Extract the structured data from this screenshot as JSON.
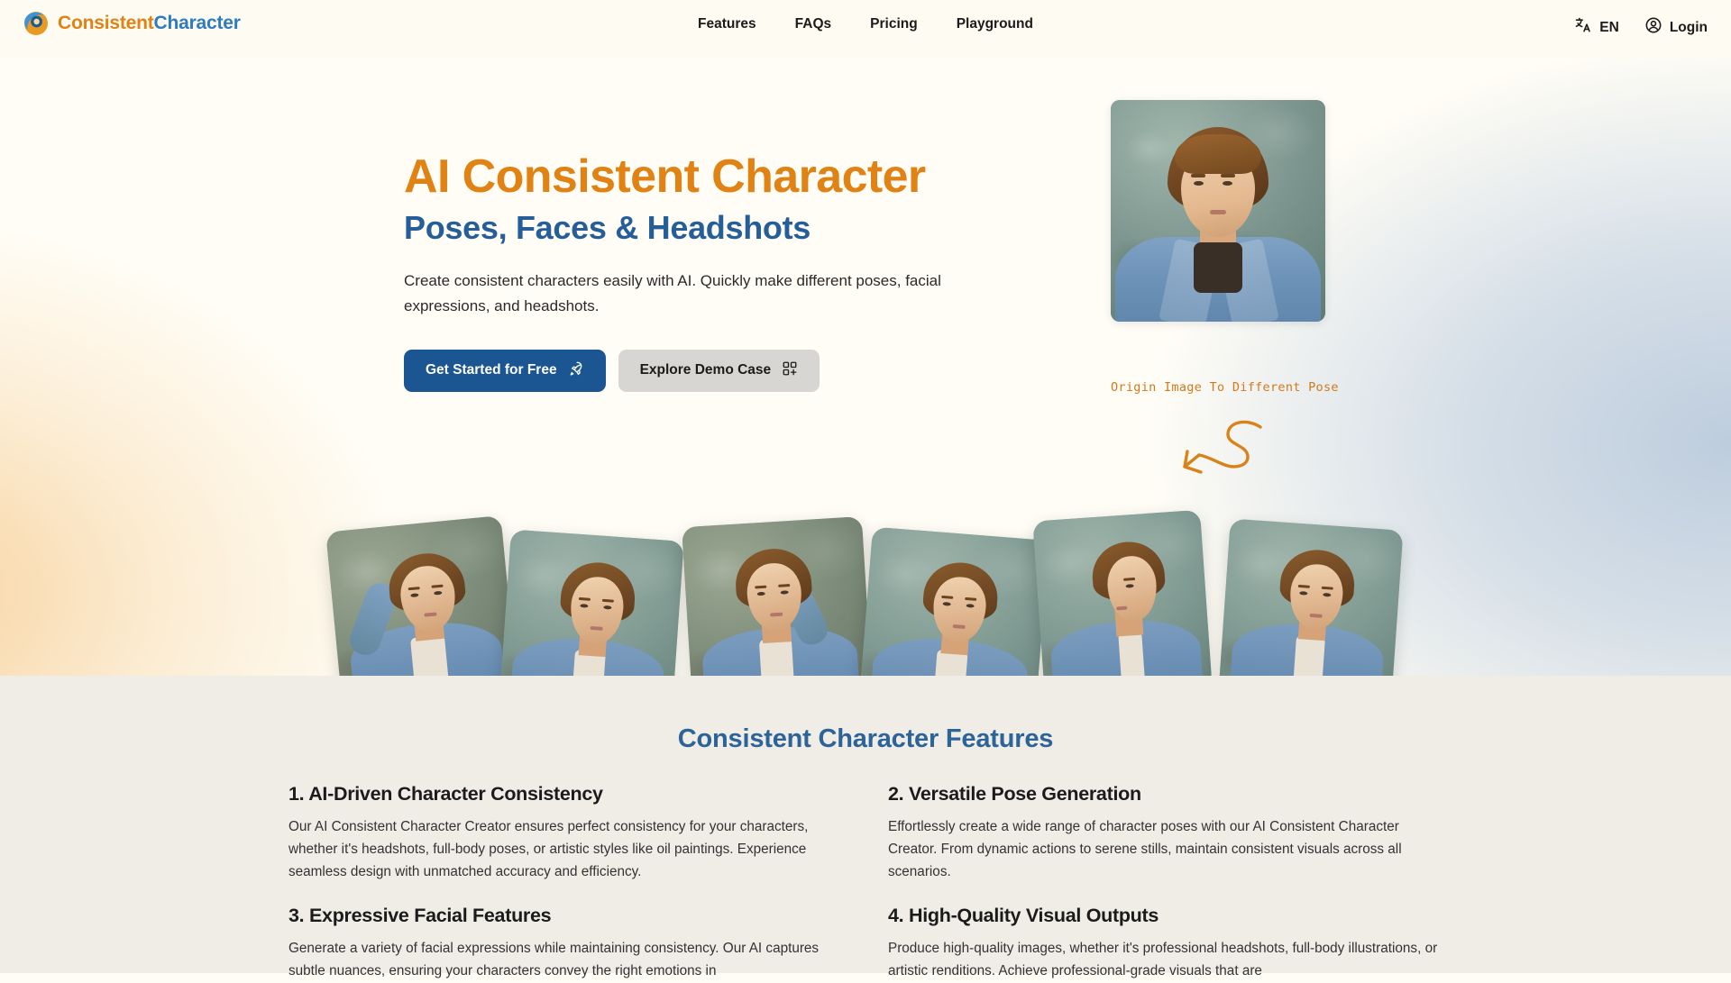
{
  "header": {
    "logo": {
      "part_a": "Consistent",
      "part_b": "Character",
      "icon": "eye-logo-icon"
    },
    "nav": [
      {
        "label": "Features"
      },
      {
        "label": "FAQs"
      },
      {
        "label": "Pricing"
      },
      {
        "label": "Playground"
      }
    ],
    "language": {
      "label": "EN",
      "icon": "translate-icon"
    },
    "account": {
      "label": "Login",
      "icon": "user-circle-icon"
    }
  },
  "hero": {
    "title_line1": "AI Consistent Character",
    "title_line2": "Poses, Faces & Headshots",
    "subtitle": "Create consistent characters easily with AI. Quickly make different poses, facial expressions, and headshots.",
    "primary_button": {
      "label": "Get Started for Free",
      "icon": "rocket-icon"
    },
    "secondary_button": {
      "label": "Explore Demo Case",
      "icon": "grid-plus-icon"
    },
    "image_caption": "Origin Image To Different Pose",
    "arrow": "curved-arrow-icon"
  },
  "gallery": {
    "items": [
      {
        "alt": "pose-hand-on-head"
      },
      {
        "alt": "pose-front-facing"
      },
      {
        "alt": "pose-leaning"
      },
      {
        "alt": "pose-seated"
      },
      {
        "alt": "pose-profile"
      },
      {
        "alt": "pose-portrait"
      }
    ]
  },
  "features": {
    "title": "Consistent Character Features",
    "items": [
      {
        "heading": "1. AI-Driven Character Consistency",
        "body": "Our AI Consistent Character Creator ensures perfect consistency for your characters, whether it's headshots, full-body poses, or artistic styles like oil paintings. Experience seamless design with unmatched accuracy and efficiency."
      },
      {
        "heading": "2. Versatile Pose Generation",
        "body": "Effortlessly create a wide range of character poses with our AI Consistent Character Creator. From dynamic actions to serene stills, maintain consistent visuals across all scenarios."
      },
      {
        "heading": "3. Expressive Facial Features",
        "body": "Generate a variety of facial expressions while maintaining consistency. Our AI captures subtle nuances, ensuring your characters convey the right emotions in"
      },
      {
        "heading": "4. High-Quality Visual Outputs",
        "body": "Produce high-quality images, whether it's professional headshots, full-body illustrations, or artistic renditions. Achieve professional-grade visuals that are"
      }
    ]
  },
  "colors": {
    "brand_orange": "#E08214",
    "brand_blue": "#2E7BBF",
    "heading_blue": "#255E98",
    "primary_button_bg": "#1B5693",
    "secondary_button_bg": "#D8D6D2",
    "features_bg": "#EFEDE6",
    "page_bg": "#FFFDF5"
  }
}
